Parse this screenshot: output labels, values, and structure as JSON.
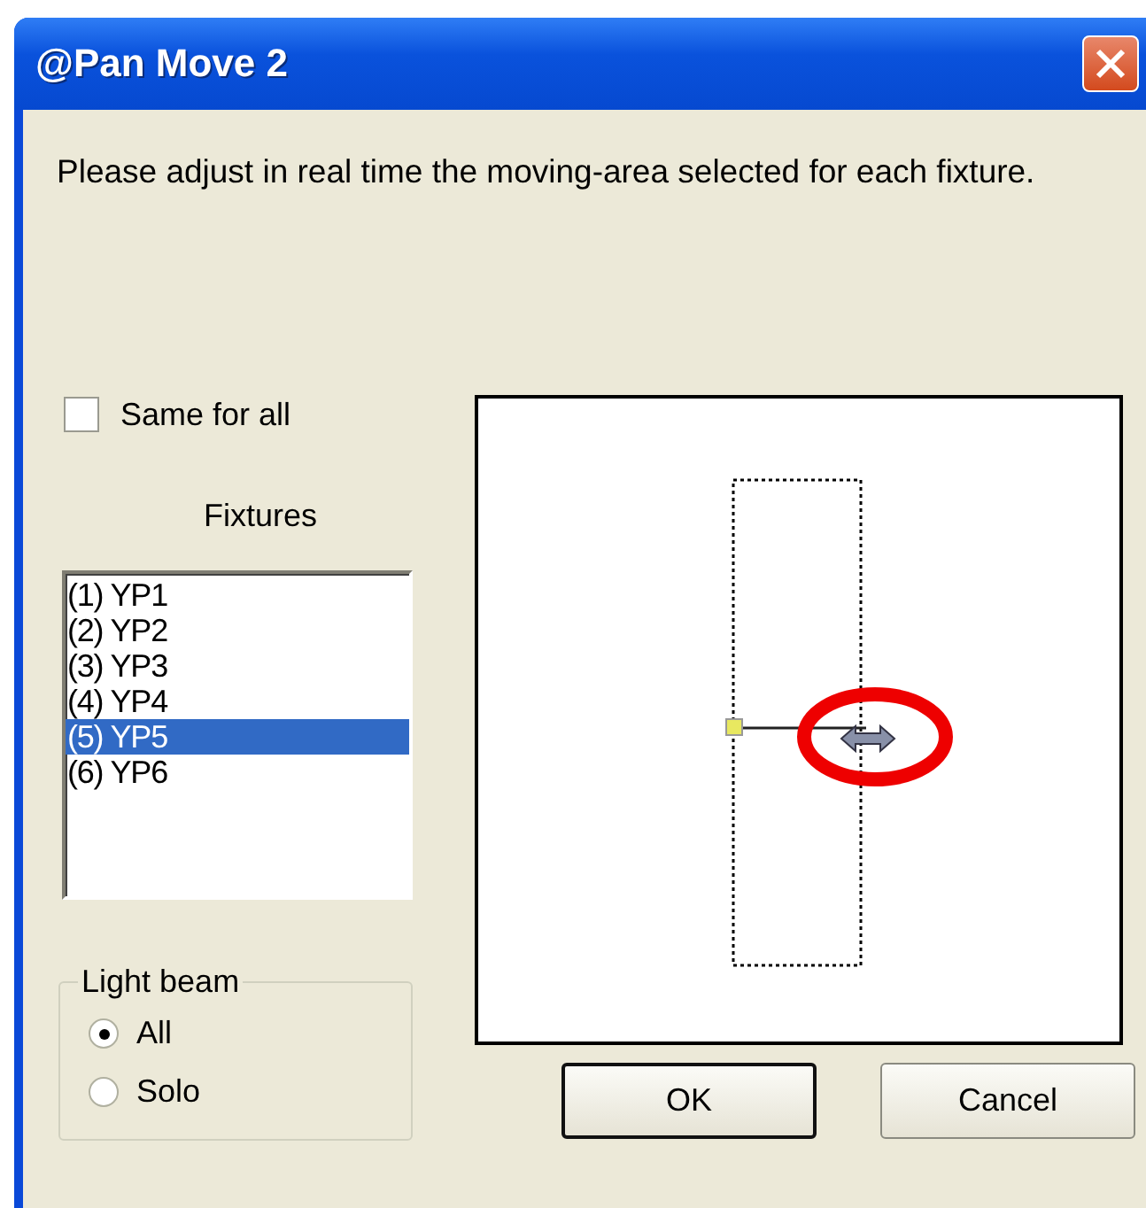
{
  "window": {
    "title": "@Pan Move 2"
  },
  "instruction": "Please adjust in real time the moving-area selected for each fixture.",
  "same_for_all": {
    "label": "Same for all",
    "checked": false
  },
  "fixtures": {
    "label": "Fixtures",
    "items": [
      {
        "label": "(1) YP1",
        "selected": false
      },
      {
        "label": "(2) YP2",
        "selected": false
      },
      {
        "label": "(3) YP3",
        "selected": false
      },
      {
        "label": "(4) YP4",
        "selected": false
      },
      {
        "label": "(5) YP5",
        "selected": true
      },
      {
        "label": "(6) YP6",
        "selected": false
      }
    ]
  },
  "light_beam": {
    "title": "Light beam",
    "options": [
      {
        "label": "All",
        "selected": true
      },
      {
        "label": "Solo",
        "selected": false
      }
    ]
  },
  "buttons": [
    {
      "label": "OK",
      "default": true
    },
    {
      "label": "Cancel",
      "default": false
    }
  ]
}
